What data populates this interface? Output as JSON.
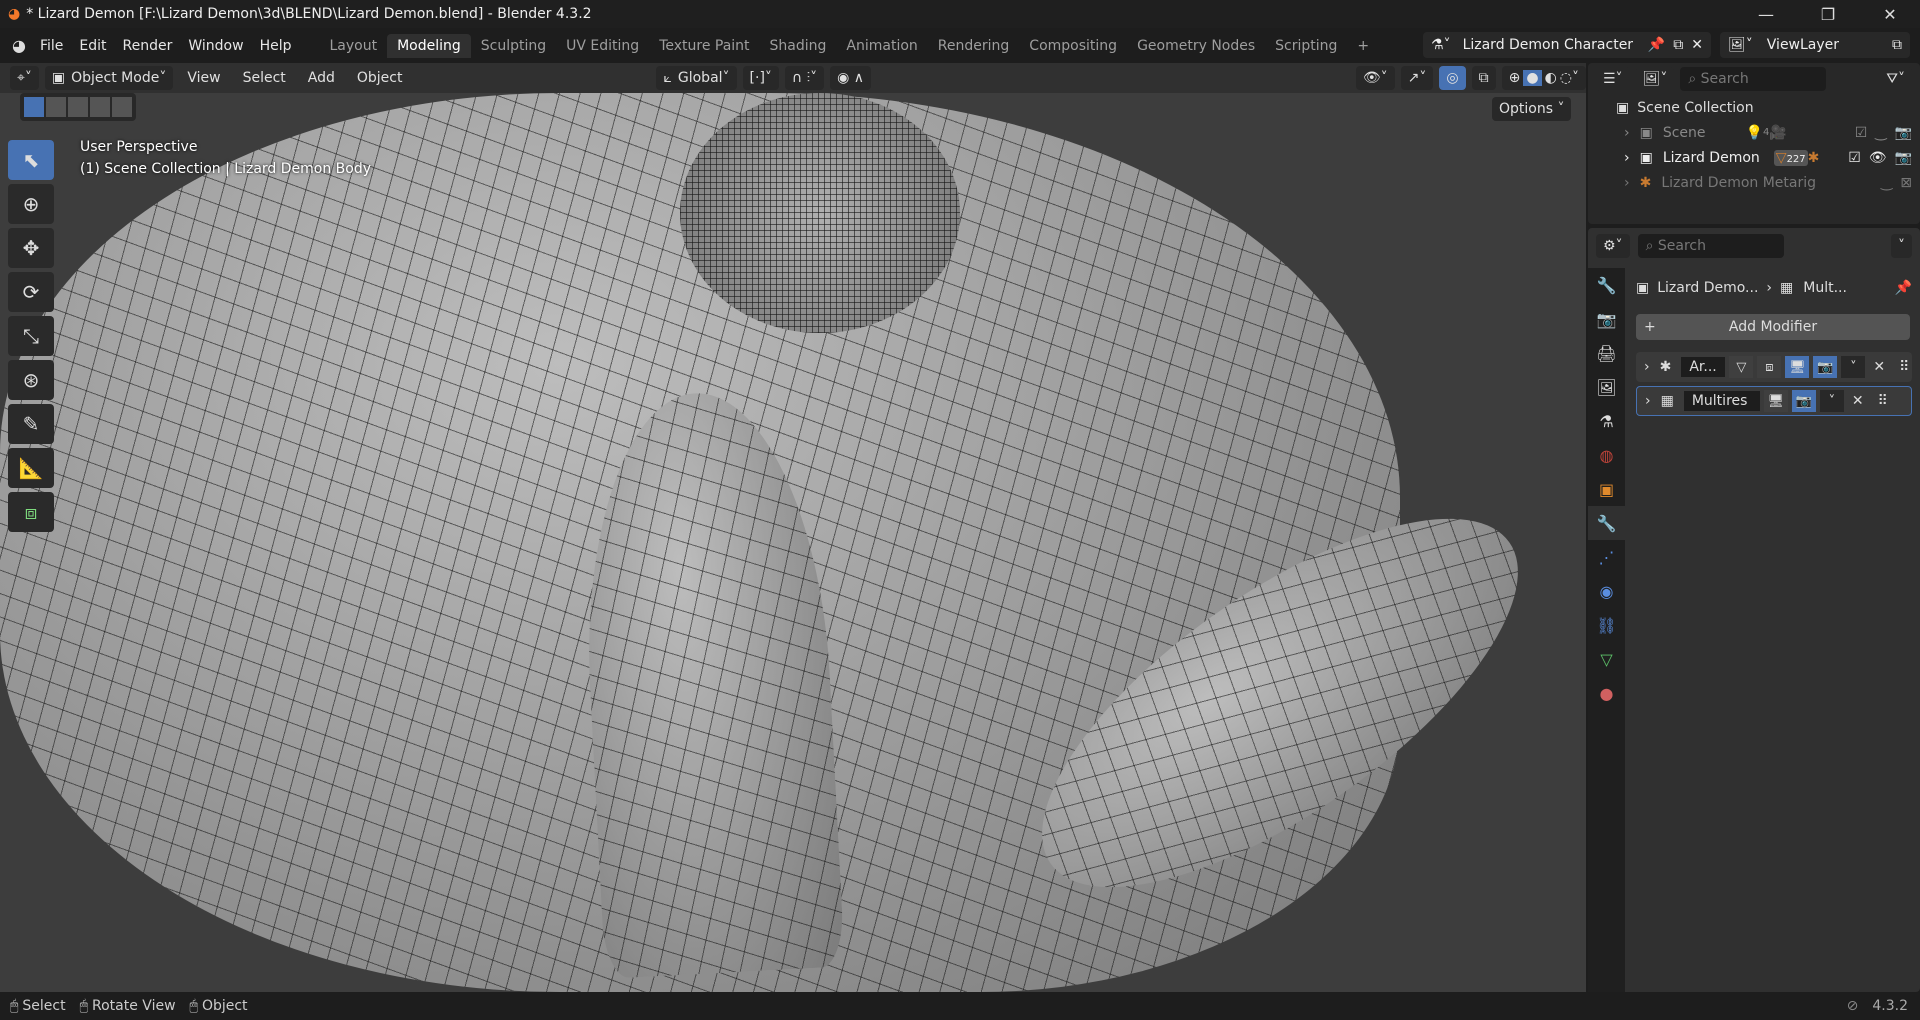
{
  "window": {
    "title": "* Lizard Demon [F:\\Lizard Demon\\3d\\BLEND\\Lizard Demon.blend] - Blender 4.3.2",
    "minimize": "—",
    "maximize": "❐",
    "close": "✕"
  },
  "menus": [
    "File",
    "Edit",
    "Render",
    "Window",
    "Help"
  ],
  "workspaces": [
    "Layout",
    "Modeling",
    "Sculpting",
    "UV Editing",
    "Texture Paint",
    "Shading",
    "Animation",
    "Rendering",
    "Compositing",
    "Geometry Nodes",
    "Scripting"
  ],
  "active_workspace": "Modeling",
  "scene_selector": "Lizard Demon Character",
  "view_layer": "ViewLayer",
  "viewport": {
    "mode": "Object Mode",
    "menus": [
      "View",
      "Select",
      "Add",
      "Object"
    ],
    "orientation": "Global",
    "options": "Options",
    "info_line1": "User Perspective",
    "info_line2": "(1) Scene Collection | Lizard Demon Body"
  },
  "outliner": {
    "search_placeholder": "Search",
    "root": "Scene Collection",
    "items": [
      {
        "label": "Scene",
        "badge": "4"
      },
      {
        "label": "Lizard Demon",
        "badge": "227"
      },
      {
        "label": "Lizard Demon Metarig"
      }
    ]
  },
  "properties": {
    "search_placeholder": "Search",
    "breadcrumb_object": "Lizard Demo...",
    "breadcrumb_modifier": "Mult...",
    "add_modifier": "Add Modifier",
    "modifiers": [
      {
        "name": "Ar..."
      },
      {
        "name": "Multires"
      }
    ]
  },
  "statusbar": {
    "select": "Select",
    "rotate": "Rotate View",
    "object": "Object",
    "version": "4.3.2"
  }
}
